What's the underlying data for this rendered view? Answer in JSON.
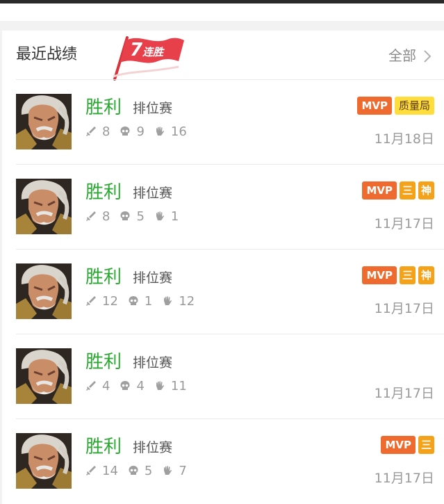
{
  "section": {
    "title": "最近战绩",
    "all_label": "全部"
  },
  "streak": {
    "count": "7",
    "label": "连胜"
  },
  "matches": [
    {
      "result": "胜利",
      "mode": "排位赛",
      "kills": "8",
      "deaths": "9",
      "assists": "16",
      "date": "11月18日",
      "tags": [
        "MVP",
        "质量局"
      ]
    },
    {
      "result": "胜利",
      "mode": "排位赛",
      "kills": "8",
      "deaths": "5",
      "assists": "1",
      "date": "11月17日",
      "tags": [
        "MVP",
        "三",
        "神"
      ]
    },
    {
      "result": "胜利",
      "mode": "排位赛",
      "kills": "12",
      "deaths": "1",
      "assists": "12",
      "date": "11月17日",
      "tags": [
        "MVP",
        "三",
        "神"
      ]
    },
    {
      "result": "胜利",
      "mode": "排位赛",
      "kills": "4",
      "deaths": "4",
      "assists": "11",
      "date": "11月17日",
      "tags": []
    },
    {
      "result": "胜利",
      "mode": "排位赛",
      "kills": "14",
      "deaths": "5",
      "assists": "7",
      "date": "11月17日",
      "tags": [
        "MVP",
        "三"
      ]
    }
  ],
  "colors": {
    "victory": "#2aa831",
    "mvp_tag": "#ee6a2e",
    "quality_tag": "#ffdd3c",
    "triple_tag": "#f3a21a",
    "streak_flag": "#e8404a"
  },
  "icons": {
    "kills": "sword-icon",
    "deaths": "skull-icon",
    "assists": "hand-icon",
    "more": "chevron-right-icon",
    "streak": "flag-icon",
    "hero": "hero-avatar"
  }
}
